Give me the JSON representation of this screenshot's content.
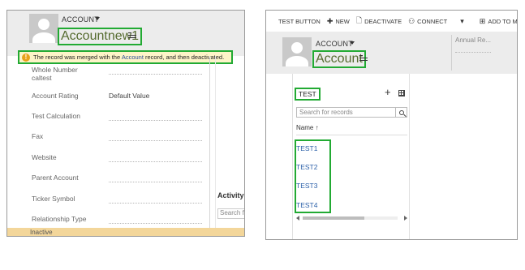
{
  "left": {
    "entity_label": "ACCOUNT",
    "record_name": "Accountnew1",
    "notification": {
      "prefix": "The record was merged with the",
      "link": "Account",
      "suffix": "record, and then deactivated."
    },
    "fields": [
      {
        "label": "Whole Number",
        "value": ""
      },
      {
        "label": "caltest",
        "value": ""
      },
      {
        "label": "Account Rating",
        "value": "Default Value"
      },
      {
        "label": "Test Calculation",
        "value": ""
      },
      {
        "label": "Fax",
        "value": ""
      },
      {
        "label": "Website",
        "value": ""
      },
      {
        "label": "Parent Account",
        "value": ""
      },
      {
        "label": "Ticker Symbol",
        "value": ""
      },
      {
        "label": "Relationship Type",
        "value": ""
      }
    ],
    "subgrid_header": "Activity",
    "subgrid_search_placeholder": "Search fo",
    "status": "Inactive"
  },
  "right": {
    "commands": [
      {
        "label": "TEST BUTTON",
        "icon": ""
      },
      {
        "label": "NEW",
        "icon": "plus-icon"
      },
      {
        "label": "DEACTIVATE",
        "icon": "document-icon"
      },
      {
        "label": "CONNECT",
        "icon": "connect-icon"
      },
      {
        "label": "ADD TO MAR",
        "icon": "add-to-list-icon"
      }
    ],
    "entity_label": "ACCOUNT",
    "record_name": "Account",
    "header_field": "Annual Re...",
    "subgrid": {
      "title": "TEST",
      "search_placeholder": "Search for records",
      "column": "Name",
      "sort": "↑",
      "rows": [
        "TEST1",
        "TEST2",
        "TEST3",
        "TEST4"
      ]
    }
  },
  "colors": {
    "highlight_border": "#22aa33",
    "notification_bg": "#fdf4c8",
    "status_bar_bg": "#f3d69a",
    "link": "#2a5fa8"
  }
}
